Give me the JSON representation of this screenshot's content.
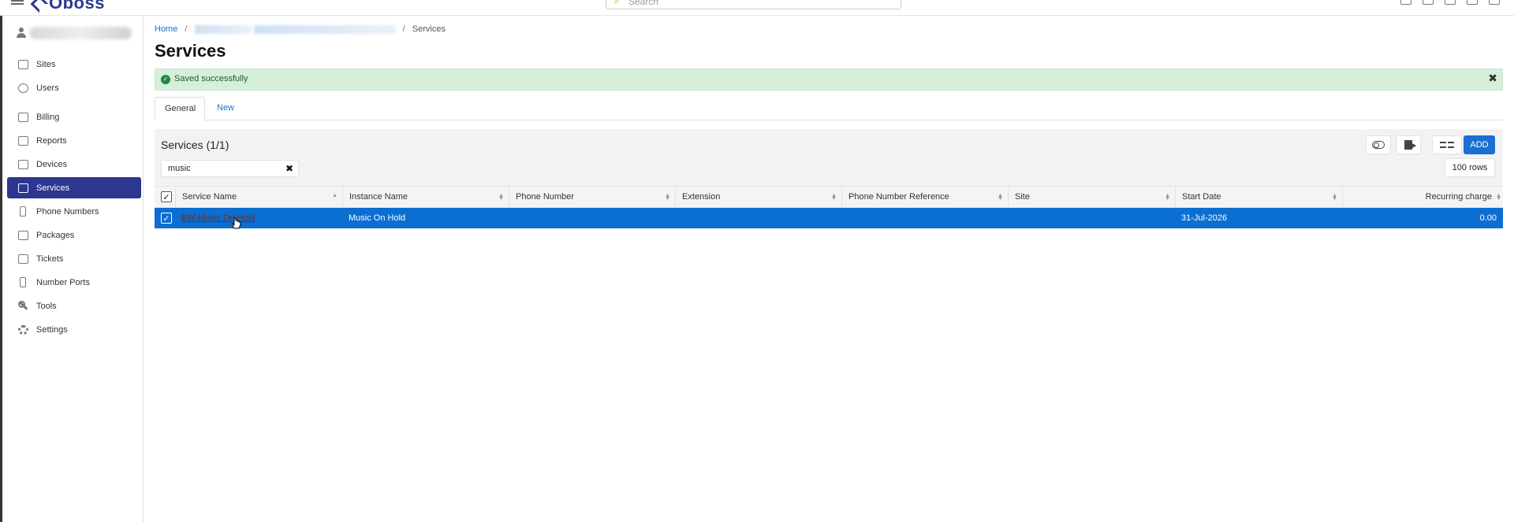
{
  "app": {
    "logo_text": "Oboss",
    "search_placeholder": "Search"
  },
  "sidebar": {
    "items": [
      {
        "label": "Sites",
        "icon": "building-icon"
      },
      {
        "label": "Users",
        "icon": "users-icon"
      },
      {
        "label": "Billing",
        "icon": "billing-icon"
      },
      {
        "label": "Reports",
        "icon": "chart-icon"
      },
      {
        "label": "Devices",
        "icon": "device-icon"
      },
      {
        "label": "Services",
        "icon": "services-icon",
        "active": true
      },
      {
        "label": "Phone Numbers",
        "icon": "phone-icon"
      },
      {
        "label": "Packages",
        "icon": "package-icon"
      },
      {
        "label": "Tickets",
        "icon": "ticket-icon"
      },
      {
        "label": "Number Ports",
        "icon": "phone-icon"
      },
      {
        "label": "Tools",
        "icon": "wrench-icon"
      },
      {
        "label": "Settings",
        "icon": "gear-icon"
      }
    ]
  },
  "breadcrumb": {
    "home": "Home",
    "current": "Services"
  },
  "page": {
    "title": "Services"
  },
  "alert": {
    "message": "Saved successfully",
    "close": "✖",
    "check": "✓"
  },
  "tabs": [
    {
      "label": "General"
    },
    {
      "label": "New"
    }
  ],
  "panel": {
    "title": "Services (1/1)",
    "filter_value": "music",
    "filter_clear": "✖",
    "add_label": "ADD",
    "rows_label": "100 rows"
  },
  "table": {
    "columns": [
      "Service Name",
      "Instance Name",
      "Phone Number",
      "Extension",
      "Phone Number Reference",
      "Site",
      "Start Date",
      "Recurring charge"
    ],
    "header_check": "✓",
    "rows": [
      {
        "check": "✓",
        "service_name": "BW-Music On Hold",
        "instance_name": "Music On Hold",
        "phone_number": "",
        "extension": "",
        "phone_number_reference": "",
        "site": "",
        "start_date": "31-Jul-2026",
        "recurring_charge": "0.00"
      }
    ]
  },
  "colors": {
    "brand": "#2d3691",
    "accent": "#1a6fd0",
    "selected_row": "#0b6ed1",
    "success_bg": "#d6efdc"
  }
}
